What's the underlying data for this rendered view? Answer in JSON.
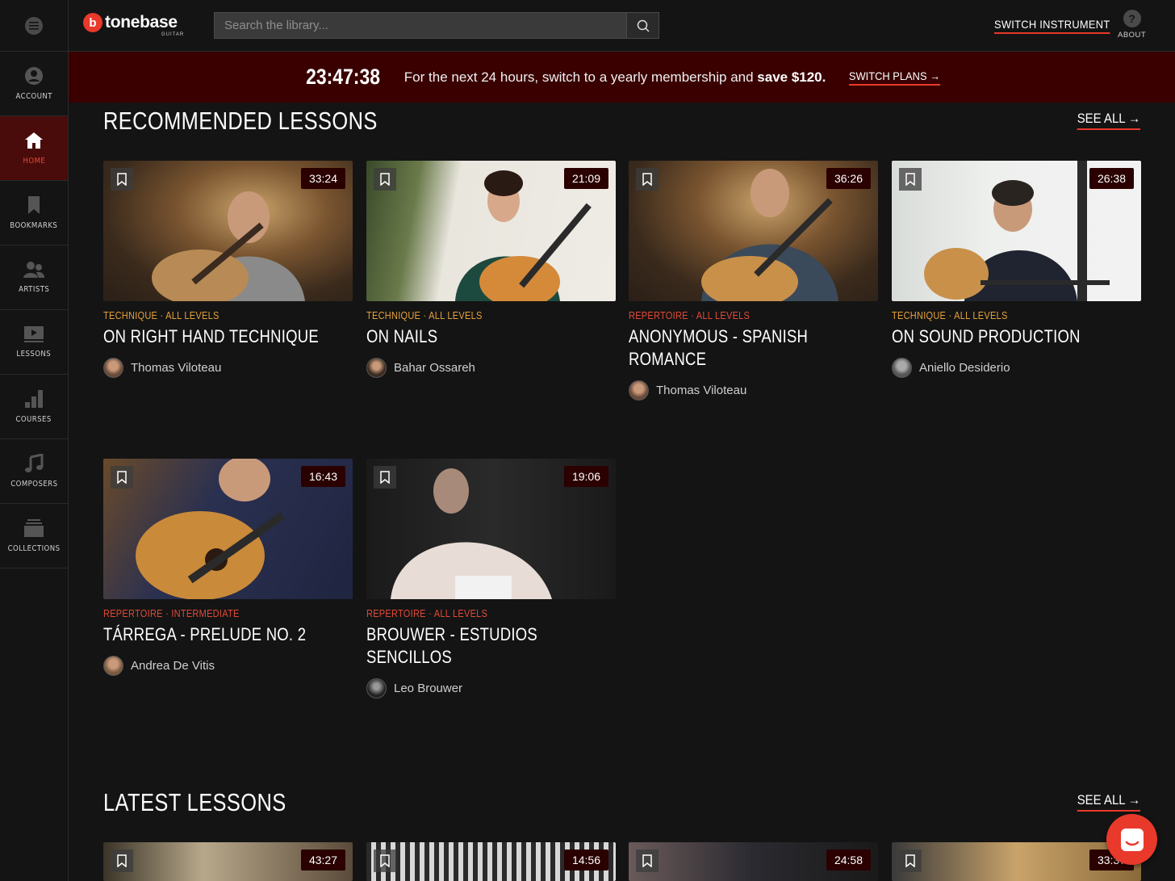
{
  "sidebar": {
    "items": [
      {
        "label": "ACCOUNT",
        "icon": "account-icon"
      },
      {
        "label": "HOME",
        "icon": "home-icon",
        "active": true
      },
      {
        "label": "BOOKMARKS",
        "icon": "bookmark-icon"
      },
      {
        "label": "ARTISTS",
        "icon": "artists-icon"
      },
      {
        "label": "LESSONS",
        "icon": "lessons-icon"
      },
      {
        "label": "COURSES",
        "icon": "courses-icon"
      },
      {
        "label": "COMPOSERS",
        "icon": "composers-icon"
      },
      {
        "label": "COLLECTIONS",
        "icon": "collections-icon"
      }
    ]
  },
  "header": {
    "logo_mark": "b",
    "logo_text": "tonebase",
    "logo_sub": "GUITAR",
    "search_placeholder": "Search the library...",
    "switch_instrument": "SWITCH INSTRUMENT",
    "about_label": "ABOUT",
    "about_glyph": "?"
  },
  "promo": {
    "timer": "23:47:38",
    "message_prefix": "For the next 24 hours, switch to a yearly membership and ",
    "message_bold": "save $120.",
    "cta": "SWITCH PLANS →"
  },
  "recommended": {
    "title": "RECOMMENDED LESSONS",
    "see_all": "SEE ALL →",
    "cards": [
      {
        "duration": "33:24",
        "tag": "TECHNIQUE · ALL LEVELS",
        "title": "ON RIGHT HAND TECHNIQUE",
        "artist": "Thomas Viloteau"
      },
      {
        "duration": "21:09",
        "tag": "TECHNIQUE · ALL LEVELS",
        "title": "ON NAILS",
        "artist": "Bahar Ossareh"
      },
      {
        "duration": "36:26",
        "tag": "REPERTOIRE · ALL LEVELS",
        "title": "ANONYMOUS - SPANISH ROMANCE",
        "artist": "Thomas Viloteau"
      },
      {
        "duration": "26:38",
        "tag": "TECHNIQUE · ALL LEVELS",
        "title": "ON SOUND PRODUCTION",
        "artist": "Aniello Desiderio"
      },
      {
        "duration": "16:43",
        "tag": "REPERTOIRE · INTERMEDIATE",
        "title": "TÁRREGA - PRELUDE NO. 2",
        "artist": "Andrea De Vitis"
      },
      {
        "duration": "19:06",
        "tag": "REPERTOIRE · ALL LEVELS",
        "title": "BROUWER - ESTUDIOS SENCILLOS",
        "artist": "Leo Brouwer"
      }
    ]
  },
  "latest": {
    "title": "LATEST LESSONS",
    "see_all": "SEE ALL →",
    "durations": [
      "43:27",
      "14:56",
      "24:58",
      "33:37"
    ]
  },
  "colors": {
    "accent": "#e8392b",
    "technique_tag": "#e5a13a",
    "repertoire_tag": "#e14a38",
    "promo_bg": "#3a0000",
    "active_nav_bg": "#4a0b0b"
  }
}
